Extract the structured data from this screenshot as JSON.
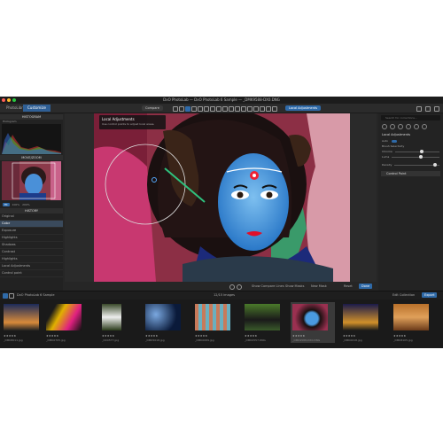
{
  "window": {
    "title": "DxO PhotoLab — DxO PhotoLab 6 Sample — _DMK9588-DX0.DNG"
  },
  "tabs": [
    {
      "label": "PhotoLibrary"
    },
    {
      "label": "Customize"
    }
  ],
  "toolbar": {
    "compare_label": "Compare",
    "local_adjustments_label": "Local Adjustments"
  },
  "left_panel": {
    "histogram_title": "HISTOGRAM",
    "histogram_caption": "Histogram",
    "navigator_title": "MOVE/ZOOM",
    "history_title": "HISTORY",
    "history_items": [
      {
        "label": "Original"
      },
      {
        "label": "Color"
      },
      {
        "label": "Exposure"
      },
      {
        "label": "Highlights"
      },
      {
        "label": "Shadows"
      },
      {
        "label": "Contrast"
      },
      {
        "label": "Highlights"
      },
      {
        "label": "Local Adjustments"
      },
      {
        "label": "Control point"
      }
    ],
    "nav_buttons": {
      "fit": "Fit",
      "zoom_100": "100%",
      "zoom_200": "200%"
    }
  },
  "center": {
    "tooltip_title": "Local Adjustments",
    "tooltip_body": "Use control points to adjust local areas.",
    "viewer_bar": {
      "compare_label": "Show Compare Lines",
      "masks_label": "Show Masks",
      "new_mask_label": "New Mask",
      "reset_label": "Reset",
      "done_label": "Done"
    }
  },
  "right_panel": {
    "search_placeholder": "Search for corrections...",
    "section_title": "Local Adjustments",
    "auto_label": "Auto",
    "slider_labels": [
      "Brush Selectivity",
      "Chroma",
      "Luma",
      "Density"
    ],
    "slider_levels": [
      0.6,
      0.6,
      0.9
    ],
    "sub_panel": "Control Point"
  },
  "filmstrip": {
    "project_label": "DxO PhotoLab 6 Sample",
    "count_label": "12/15 images",
    "collection_label": "Edit Collection",
    "export_label": "Export",
    "thumbs": [
      {
        "name": "_DMK8011.jpg",
        "stars": "★★★★★"
      },
      {
        "name": "_DMK0705.jpg",
        "stars": "★★★★★"
      },
      {
        "name": "_DX0577.jpg",
        "stars": "★★★★★"
      },
      {
        "name": "_DMK5018.jpg",
        "stars": "★★★★★"
      },
      {
        "name": "_DMK0089.jpg",
        "stars": "★★★★★"
      },
      {
        "name": "_DMK0557.DNG",
        "stars": "★★★★★"
      },
      {
        "name": "_DMK9588-DX0.DNG",
        "stars": "★★★★★"
      },
      {
        "name": "_DMK0018.jpg",
        "stars": "★★★★★"
      },
      {
        "name": "_DMK8105.jpg",
        "stars": "★★★★★"
      }
    ]
  },
  "colors": {
    "accent": "#2f6aa8",
    "background": "#262626",
    "panel": "#222222"
  }
}
